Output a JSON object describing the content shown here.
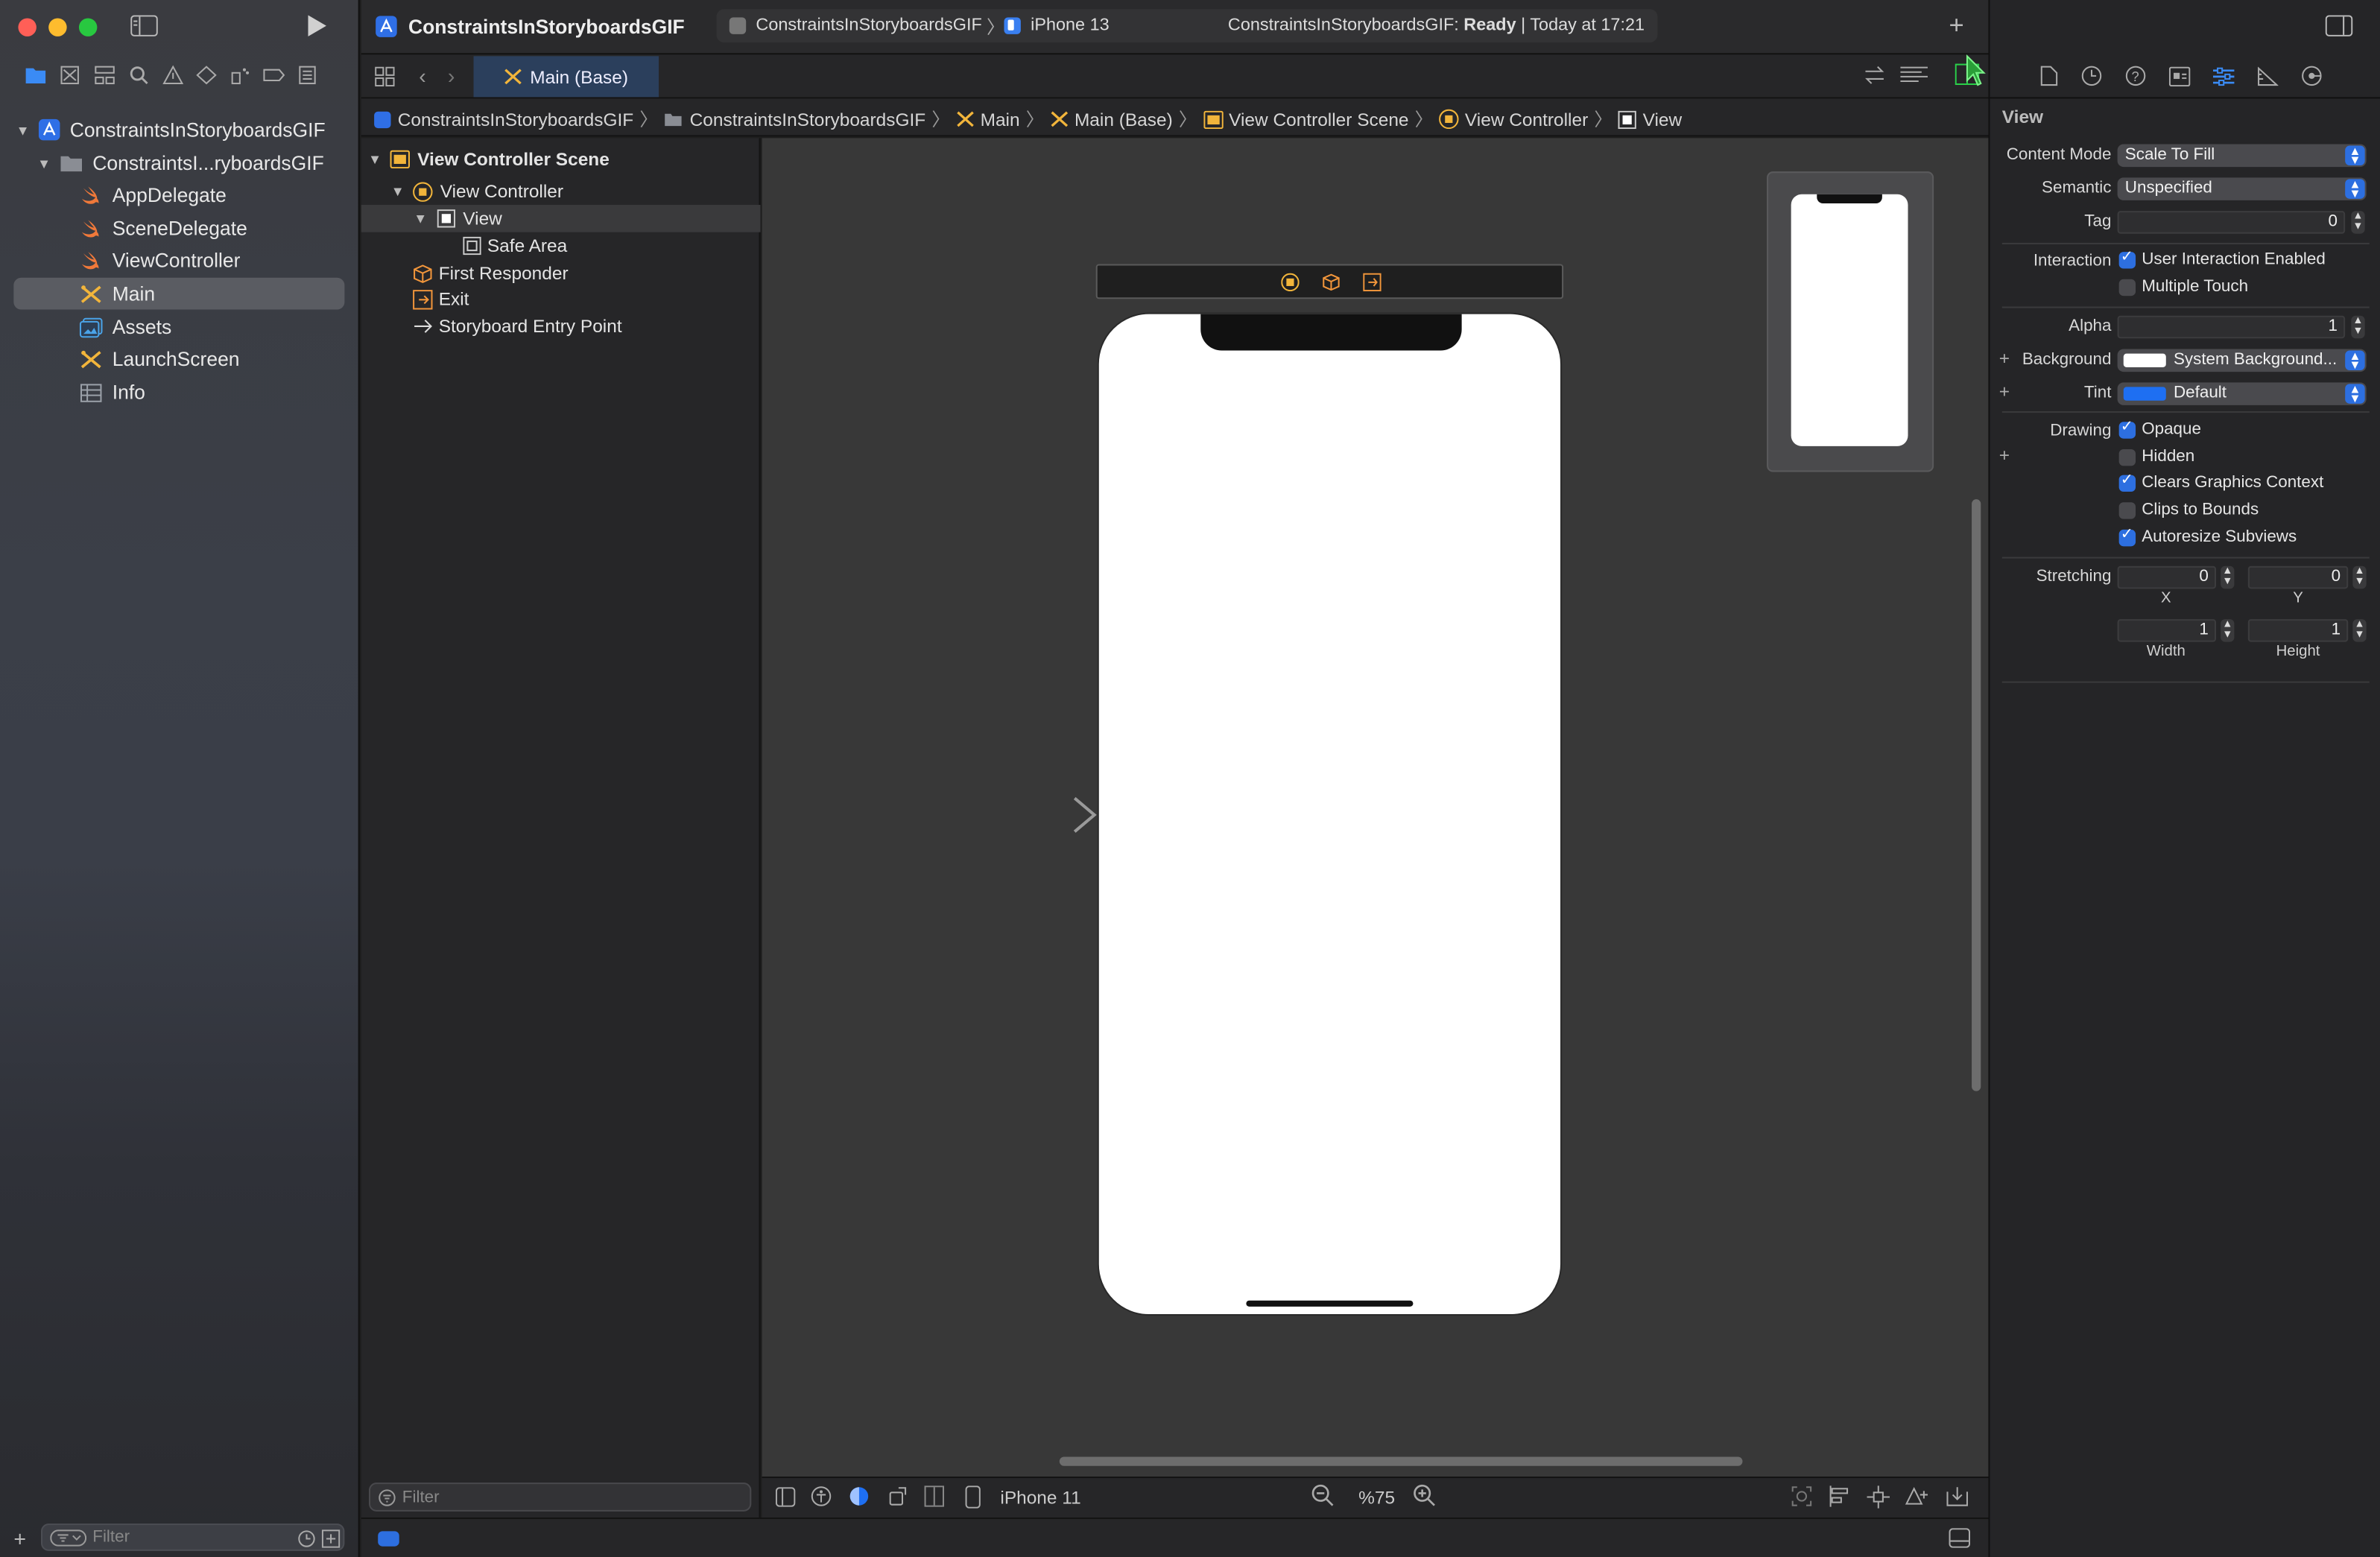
{
  "window": {
    "traffic_colors": [
      "#ff5f57",
      "#febc2e",
      "#28c840"
    ]
  },
  "toolbar": {
    "project_title": "ConstraintsInStoryboardsGIF",
    "scheme": "ConstraintsInStoryboardsGIF",
    "device": "iPhone 13",
    "status_prefix": "ConstraintsInStoryboardsGIF: ",
    "status_state": "Ready",
    "status_time": " | Today at 17:21"
  },
  "navigator": {
    "filter_placeholder": "Filter",
    "items": [
      {
        "label": "ConstraintsInStoryboardsGIF",
        "icon": "project-icon"
      },
      {
        "label": "ConstraintsI...ryboardsGIF",
        "icon": "folder-icon"
      },
      {
        "label": "AppDelegate",
        "icon": "swift-icon"
      },
      {
        "label": "SceneDelegate",
        "icon": "swift-icon"
      },
      {
        "label": "ViewController",
        "icon": "swift-icon"
      },
      {
        "label": "Main",
        "icon": "storyboard-icon"
      },
      {
        "label": "Assets",
        "icon": "assets-icon"
      },
      {
        "label": "LaunchScreen",
        "icon": "storyboard-icon"
      },
      {
        "label": "Info",
        "icon": "plist-icon"
      }
    ]
  },
  "tabs": {
    "active": "Main (Base)"
  },
  "jumpbar": {
    "items": [
      "ConstraintsInStoryboardsGIF",
      "ConstraintsInStoryboardsGIF",
      "Main",
      "Main (Base)",
      "View Controller Scene",
      "View Controller",
      "View"
    ]
  },
  "outline": {
    "items": [
      "View Controller Scene",
      "View Controller",
      "View",
      "Safe Area",
      "First Responder",
      "Exit",
      "Storyboard Entry Point"
    ],
    "filter_placeholder": "Filter"
  },
  "canvas_bar": {
    "device": "iPhone 11",
    "zoom": "%75"
  },
  "inspector": {
    "section_title": "View",
    "content_mode_label": "Content Mode",
    "content_mode_value": "Scale To Fill",
    "semantic_label": "Semantic",
    "semantic_value": "Unspecified",
    "tag_label": "Tag",
    "tag_value": "0",
    "interaction_label": "Interaction",
    "user_interaction": "User Interaction Enabled",
    "multiple_touch": "Multiple Touch",
    "alpha_label": "Alpha",
    "alpha_value": "1",
    "background_label": "Background",
    "background_value": "System Background...",
    "tint_label": "Tint",
    "tint_value": "Default",
    "drawing_label": "Drawing",
    "opaque": "Opaque",
    "hidden": "Hidden",
    "clears_graphics": "Clears Graphics Context",
    "clips_bounds": "Clips to Bounds",
    "autoresize": "Autoresize Subviews",
    "stretching_label": "Stretching",
    "stretch_x": "0",
    "stretch_y": "0",
    "stretch_w": "1",
    "stretch_h": "1",
    "x_label": "X",
    "y_label": "Y",
    "width_label": "Width",
    "height_label": "Height",
    "accent_color": "#2d6fe0",
    "tint_color": "#1e6ff2"
  }
}
